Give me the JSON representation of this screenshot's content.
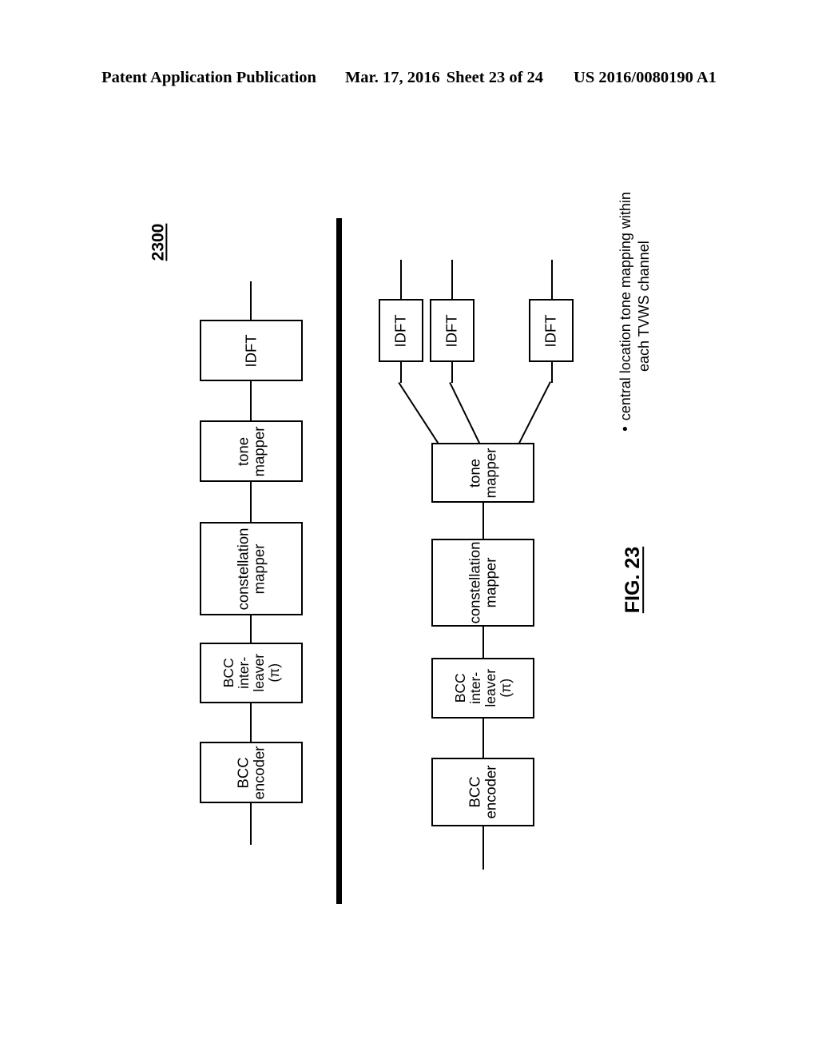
{
  "header": {
    "publication": "Patent Application Publication",
    "date": "Mar. 17, 2016",
    "sheet": "Sheet 23 of 24",
    "patent_number": "US 2016/0080190 A1"
  },
  "figure": {
    "reference_numeral": "2300",
    "caption": "FIG. 23",
    "annotation": {
      "bullet": "•",
      "line1": "central location tone mapping within",
      "line2": "each TVWS channel"
    },
    "upper_chain": {
      "name": "single-IDFT transmit chain",
      "blocks": [
        {
          "id": "idft",
          "label": "IDFT",
          "lines": [
            "IDFT"
          ]
        },
        {
          "id": "tone-mapper",
          "label": "tone mapper",
          "lines": [
            "tone",
            "mapper"
          ]
        },
        {
          "id": "constellation-mapper",
          "label": "constellation mapper",
          "lines": [
            "constellation",
            "mapper"
          ]
        },
        {
          "id": "bcc-interleaver",
          "label": "BCC inter-leaver (π)",
          "lines": [
            "BCC",
            "inter-",
            "leaver",
            "(π)"
          ]
        },
        {
          "id": "bcc-encoder",
          "label": "BCC encoder",
          "lines": [
            "BCC",
            "encoder"
          ]
        }
      ]
    },
    "lower_chain": {
      "name": "multi-IDFT transmit chain",
      "idft_blocks": [
        {
          "id": "idft-1",
          "label": "IDFT"
        },
        {
          "id": "idft-2",
          "label": "IDFT"
        },
        {
          "id": "idft-3",
          "label": "IDFT"
        }
      ],
      "blocks": [
        {
          "id": "tone-mapper",
          "label": "tone mapper",
          "lines": [
            "tone",
            "mapper"
          ]
        },
        {
          "id": "constellation-mapper",
          "label": "constellation mapper",
          "lines": [
            "constellation",
            "mapper"
          ]
        },
        {
          "id": "bcc-interleaver",
          "label": "BCC inter-leaver (π)",
          "lines": [
            "BCC",
            "inter-",
            "leaver",
            "(π)"
          ]
        },
        {
          "id": "bcc-encoder",
          "label": "BCC encoder",
          "lines": [
            "BCC",
            "encoder"
          ]
        }
      ]
    },
    "colors": {
      "ink": "#000000",
      "paper": "#ffffff"
    }
  }
}
